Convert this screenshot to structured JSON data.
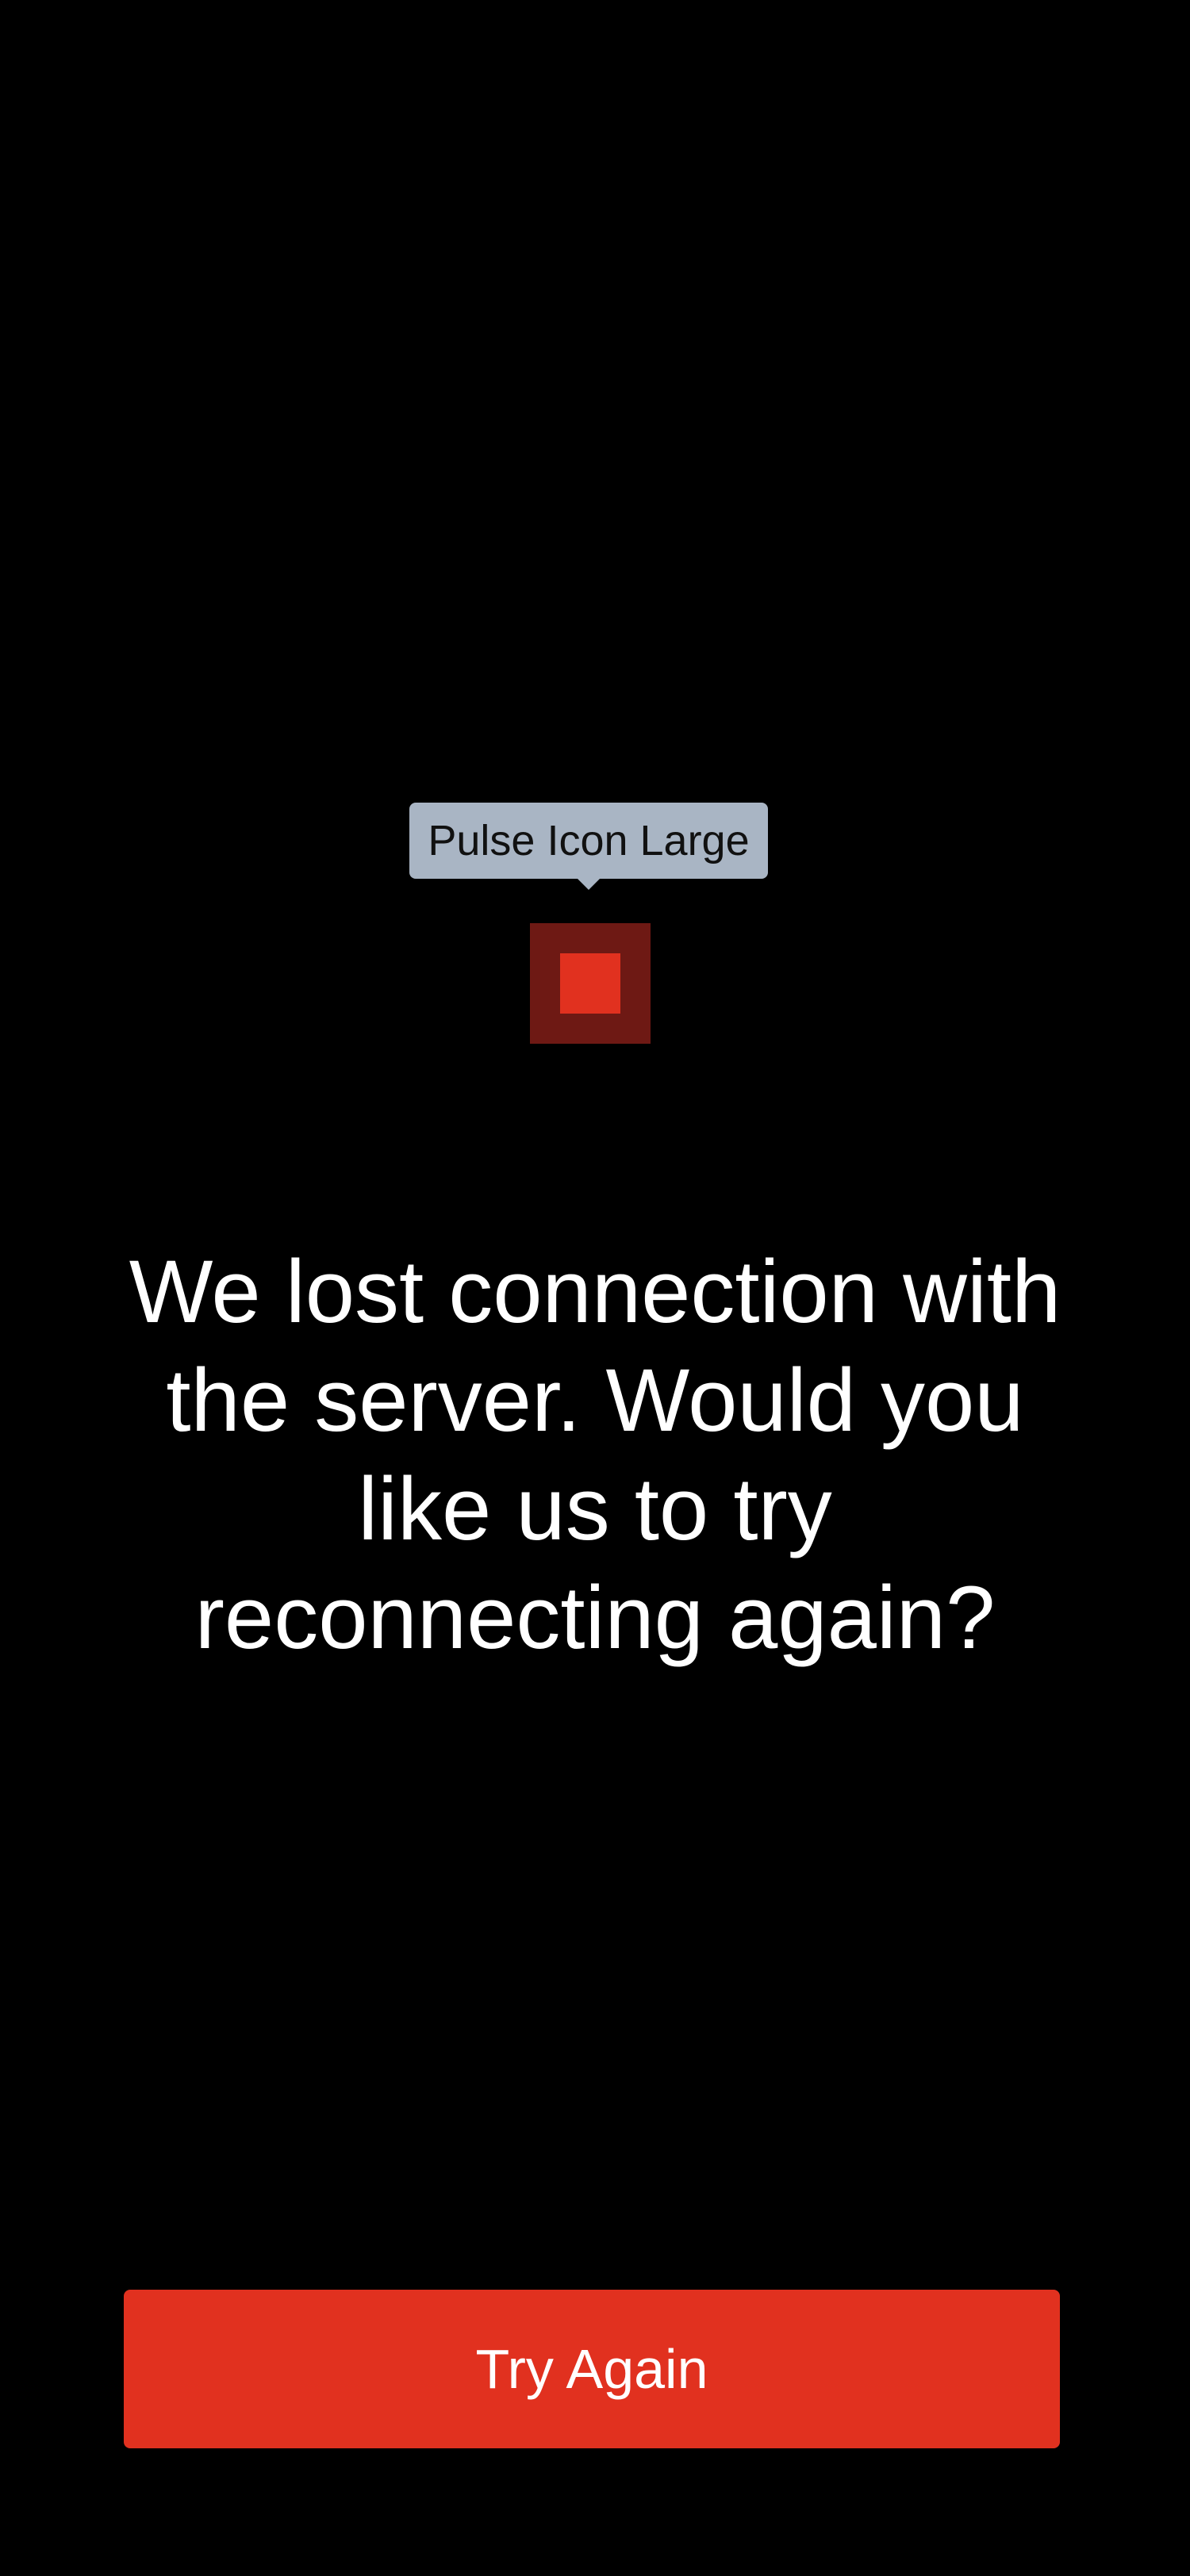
{
  "tooltip": {
    "label": "Pulse Icon Large"
  },
  "icon": {
    "name": "pulse-icon-large",
    "outer_color": "#6e1914",
    "inner_color": "#e1311f"
  },
  "message": {
    "text": "We lost connection with the server. Would you like us to try reconnecting again?"
  },
  "actions": {
    "try_again_label": "Try Again",
    "button_color": "#e1311f"
  },
  "colors": {
    "background": "#000000",
    "tooltip_bg": "#a9b5c4",
    "text": "#ffffff"
  }
}
